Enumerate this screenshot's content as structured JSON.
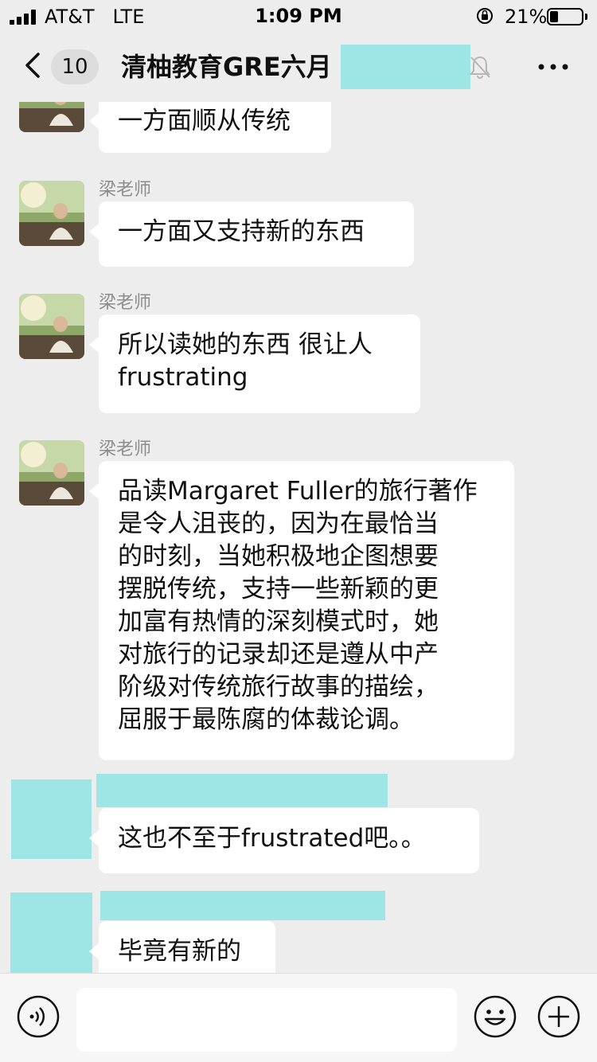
{
  "status": {
    "carrier": "AT&T   LTE",
    "time": "1:09 PM",
    "battery": "21%"
  },
  "nav": {
    "badge": "10",
    "title": "清柚教育GRE六月"
  },
  "messages": [
    {
      "sender": "",
      "text": "一方面顺从传统"
    },
    {
      "sender": "梁老师",
      "text": "一方面又支持新的东西"
    },
    {
      "sender": "梁老师",
      "text_line1": "所以读她的东西 很让人",
      "text_line2": "frustrating"
    },
    {
      "sender": "梁老师",
      "lines": [
        "品读Margaret Fuller的旅行著作",
        "是令人沮丧的，因为在最恰当",
        "的时刻，当她积极地企图想要",
        "摆脱传统，支持一些新颖的更",
        "加富有热情的深刻模式时，她",
        "对旅行的记录却还是遵从中产",
        "阶级对传统旅行故事的描绘，",
        "屈服于最陈腐的体裁论调。"
      ]
    },
    {
      "sender": "",
      "text": "这也不至于frustrated吧。。"
    },
    {
      "sender": "",
      "text": "毕竟有新的"
    }
  ],
  "input": {
    "placeholder": ""
  },
  "colors": {
    "background": "#ededed",
    "bubble": "#ffffff",
    "redaction": "#9ee6e6"
  },
  "icons": [
    "back-arrow-icon",
    "mute-bell-icon",
    "more-icon",
    "voice-icon",
    "emoji-icon",
    "plus-icon"
  ]
}
